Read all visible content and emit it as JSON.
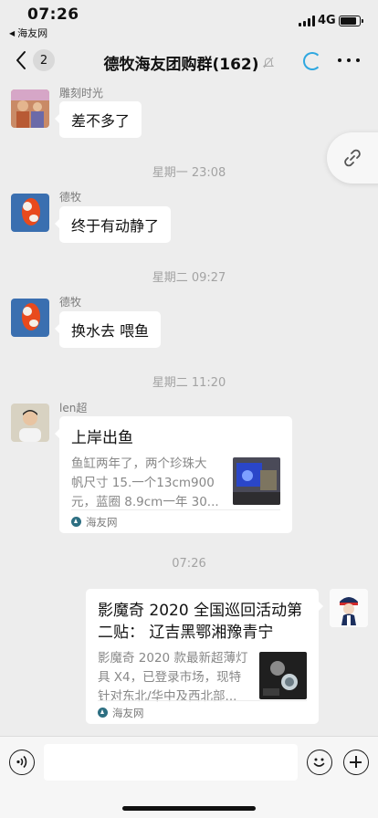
{
  "status_bar": {
    "time": "07:26",
    "back_app": "海友网",
    "network": "4G",
    "battery_level": 0.85
  },
  "nav": {
    "unread_count": "2",
    "title": "德牧海友团购群(162)"
  },
  "messages": [
    {
      "type": "text",
      "sender": "雕刻时光",
      "text": "差不多了"
    },
    {
      "type": "time",
      "text": "星期一 23:08"
    },
    {
      "type": "text",
      "sender": "德牧",
      "text": "终于有动静了"
    },
    {
      "type": "time",
      "text": "星期二 09:27"
    },
    {
      "type": "text",
      "sender": "德牧",
      "text": "换水去  喂鱼"
    },
    {
      "type": "time",
      "text": "星期二 11:20"
    },
    {
      "type": "link_card",
      "sender": "len超",
      "title": "上岸出鱼",
      "desc_line1": "鱼缸两年了，两个珍珠大",
      "desc_line2": "帆尺寸 15.一个13cm900",
      "desc_line3": "元，蓝圈 8.9cm一年 30...",
      "source": "海友网",
      "thumb_icon": "fish-tank-thumbnail"
    },
    {
      "type": "time",
      "text": "07:26"
    },
    {
      "type": "link_card",
      "sender": "",
      "title_line1": "影魔奇 2020 全国巡回活动第",
      "title_line2": "二贴：  辽吉黑鄂湘豫青宁",
      "desc_line1": "影魔奇 2020 款最新超薄灯",
      "desc_line2": "具 X4，已登录市场，现特",
      "desc_line3": "针对东北/华中及西北部...",
      "source": "海友网",
      "thumb_icon": "light-fixture-thumbnail"
    }
  ],
  "input": {
    "placeholder": "",
    "value": ""
  },
  "icons": {
    "back": "chevron-left-icon",
    "mute": "mute-bell-icon",
    "more": "more-dots-icon",
    "link": "link-icon",
    "voice": "voice-icon",
    "emoji": "emoji-icon",
    "plus": "plus-icon"
  },
  "colors": {
    "background": "#ededed",
    "bubble": "#ffffff",
    "time_label": "#a3a3a3",
    "loading_accent": "#2ea7e0"
  }
}
